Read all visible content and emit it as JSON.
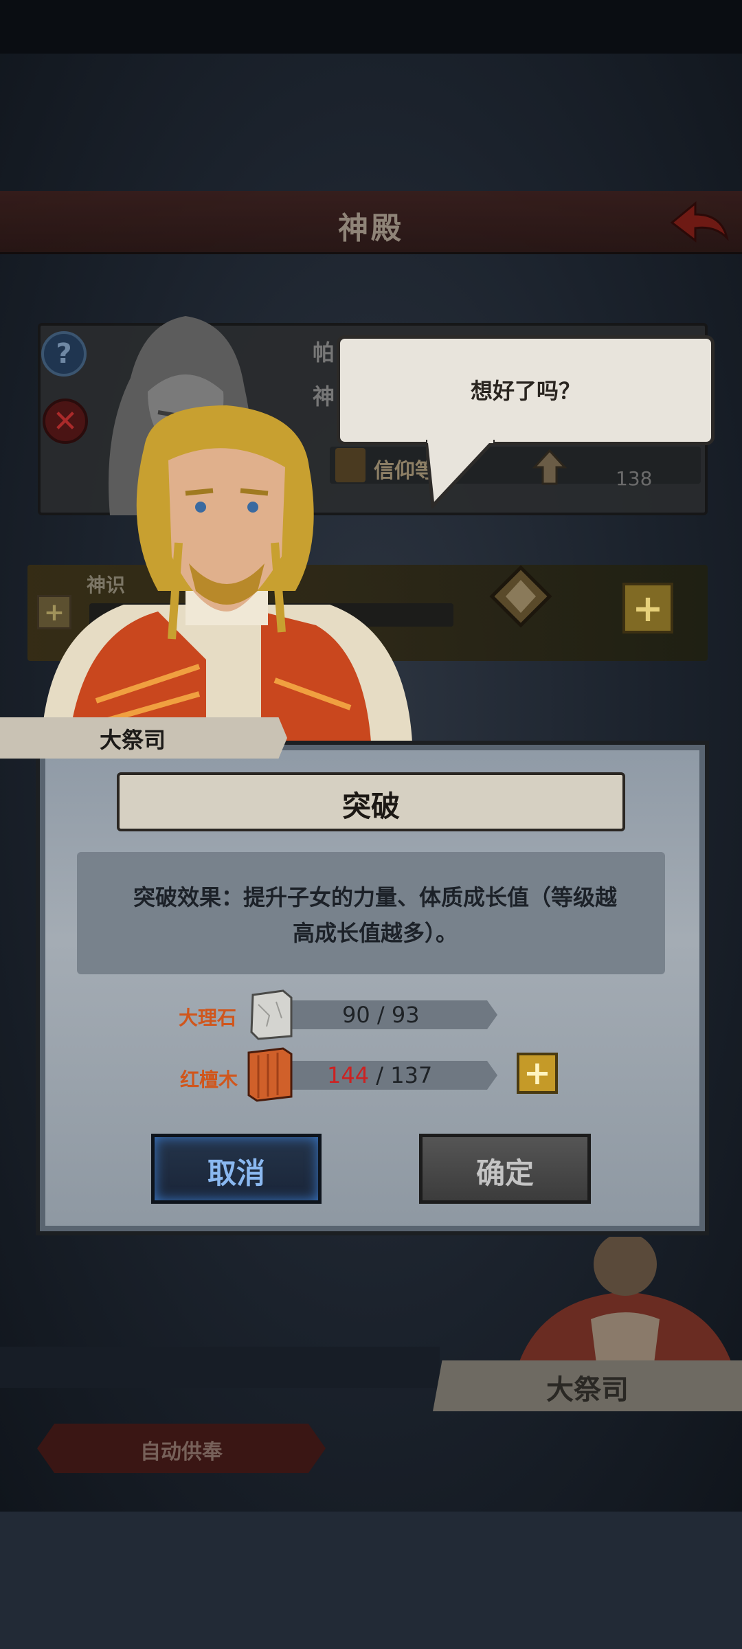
{
  "header": {
    "title": "神殿"
  },
  "background": {
    "statue_name_fragment": "帕",
    "statue_line2_fragment": "神",
    "faith_label": "信仰等",
    "faith_value": "138",
    "sense_label": "神识",
    "auto_offer_label": "自动供奉",
    "bottom_character_name": "大祭司"
  },
  "speech": {
    "text": "想好了吗？"
  },
  "speaker": {
    "name": "大祭司"
  },
  "dialog": {
    "title": "突破",
    "effect_line1": "突破效果：提升子女的力量、体质成长值（等级越",
    "effect_line2": "高成长值越多）。",
    "materials": [
      {
        "label": "大理石",
        "have": "90",
        "need": "93",
        "icon": "marble-icon"
      },
      {
        "label": "红檀木",
        "have": "144",
        "need": "137",
        "icon": "red-sandalwood-icon"
      }
    ],
    "cancel_label": "取消",
    "confirm_label": "确定"
  },
  "colors": {
    "material_label": "#d0561c",
    "insufficient_amount": "#cc2222",
    "cancel_glow": "#3a78c8",
    "plus_button": "#c59a28"
  }
}
